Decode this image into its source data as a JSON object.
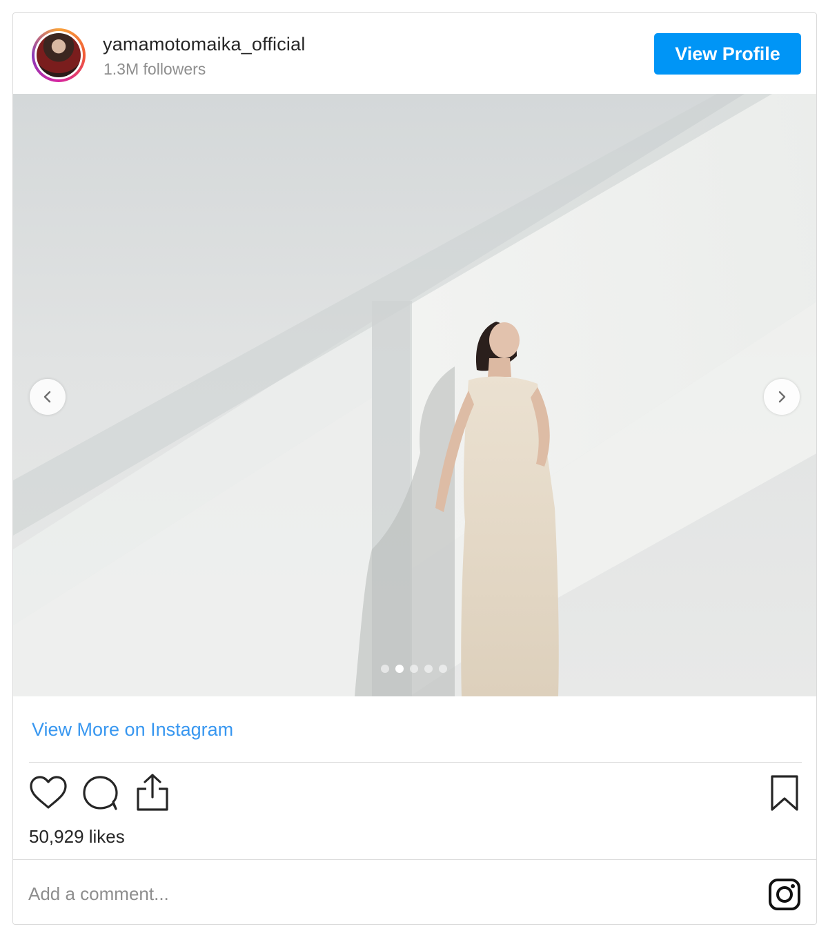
{
  "header": {
    "username": "yamamotomaika_official",
    "followers": "1.3M followers",
    "view_profile_label": "View Profile"
  },
  "post": {
    "carousel_total": 5,
    "carousel_active_index": 1,
    "view_more_label": "View More on Instagram",
    "likes": "50,929 likes",
    "comment_placeholder": "Add a comment..."
  },
  "colors": {
    "accent_button": "#0095f6",
    "link": "#3897f0",
    "text_primary": "#262626",
    "text_secondary": "#8e8e8e",
    "border": "#dbdbdb"
  },
  "icons": [
    "chevron-left-icon",
    "chevron-right-icon",
    "heart-icon",
    "comment-icon",
    "share-icon",
    "bookmark-icon",
    "instagram-icon"
  ]
}
